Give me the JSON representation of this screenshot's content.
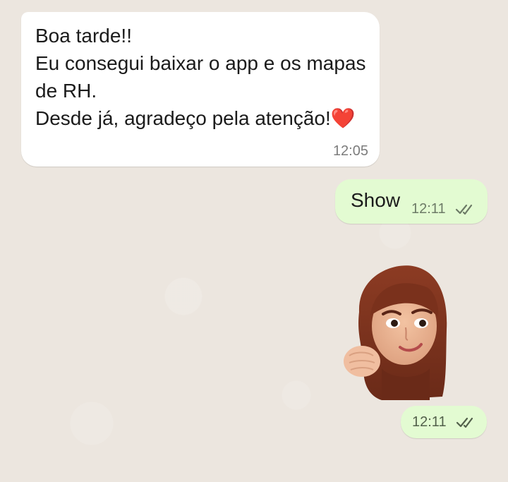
{
  "chat": {
    "incoming_message": {
      "lines": [
        "Boa tarde!!",
        "Eu consegui baixar o app e os mapas",
        "de RH.",
        "Desde já, agradeço pela atenção!"
      ],
      "emoji": "❤️",
      "time": "12:05"
    },
    "outgoing_text_message": {
      "text": "Show",
      "time": "12:11",
      "status_icon": "double-check-icon"
    },
    "outgoing_sticker_message": {
      "sticker": "memoji-fist-bump-sticker",
      "time": "12:11",
      "status_icon": "double-check-icon"
    }
  },
  "colors": {
    "background": "#ece6df",
    "incoming_bubble": "#ffffff",
    "outgoing_bubble": "#e3fbd2",
    "text": "#1b1b1b",
    "timestamp": "#7c7c7c",
    "heart": "#e0252e"
  }
}
